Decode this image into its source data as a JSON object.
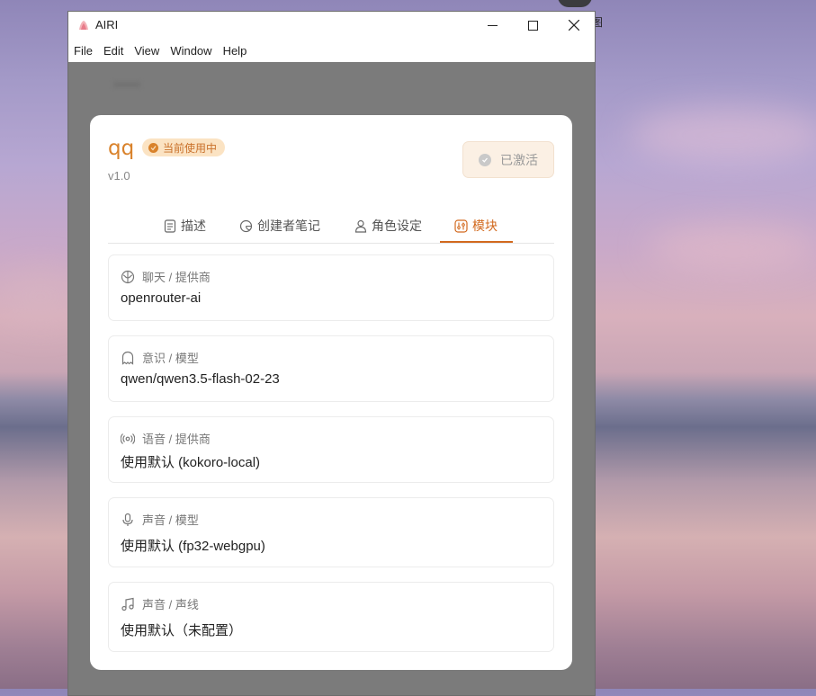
{
  "window": {
    "title": "AIRI",
    "menu": [
      "File",
      "Edit",
      "View",
      "Window",
      "Help"
    ]
  },
  "desktop": {
    "icon_label": "图"
  },
  "card": {
    "name": "qq",
    "status_badge": "当前使用中",
    "version": "v1.0",
    "activated_label": "已激活",
    "tabs": [
      {
        "label": "描述",
        "icon": "file-text-icon"
      },
      {
        "label": "创建者笔记",
        "icon": "sticky-note-icon"
      },
      {
        "label": "角色设定",
        "icon": "user-icon"
      },
      {
        "label": "模块",
        "icon": "sliders-icon"
      }
    ],
    "active_tab": "模块",
    "modules": [
      {
        "label": "聊天 / 提供商",
        "value": "openrouter-ai",
        "icon": "brain-icon"
      },
      {
        "label": "意识 / 模型",
        "value": "qwen/qwen3.5-flash-02-23",
        "icon": "ghost-icon"
      },
      {
        "label": "语音 / 提供商",
        "value": "使用默认 (kokoro-local)",
        "icon": "broadcast-icon"
      },
      {
        "label": "声音 / 模型",
        "value": "使用默认 (fp32-webgpu)",
        "icon": "microphone-icon"
      },
      {
        "label": "声音 / 声线",
        "value": "使用默认（未配置）",
        "icon": "music-note-icon"
      }
    ]
  },
  "colors": {
    "accent": "#d2691e",
    "badge_bg": "#fbe3c3",
    "activated_bg": "#fbf0e4"
  }
}
